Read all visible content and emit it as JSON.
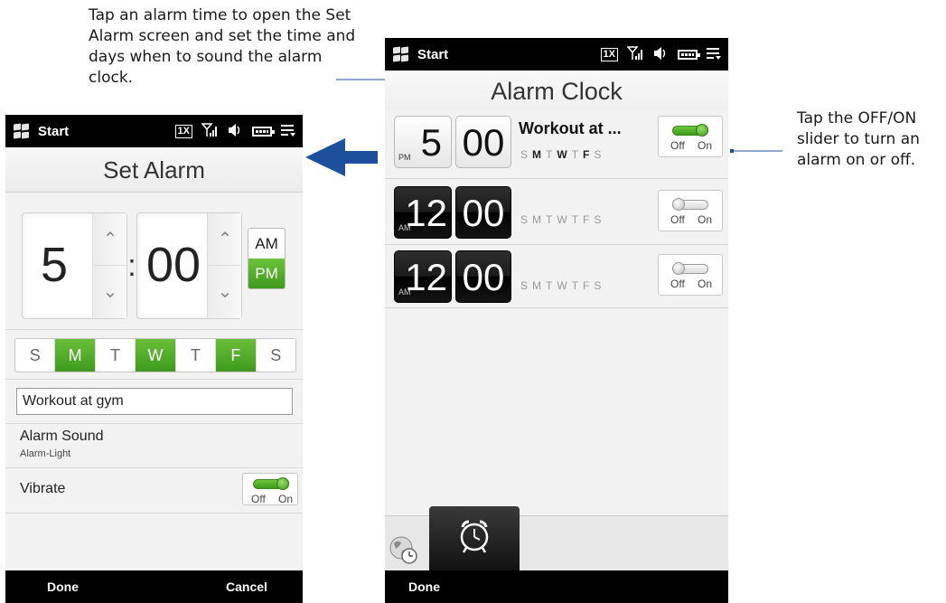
{
  "callouts": {
    "left": "Tap an alarm time to open the Set Alarm screen and set the time and days when to sound the alarm clock.",
    "right": "Tap the OFF/ON slider to turn an alarm on or off."
  },
  "status_bar": {
    "start_label": "Start",
    "network_badge": "1X",
    "icons": [
      "windows-logo-icon",
      "signal-icon",
      "speaker-icon",
      "battery-icon",
      "menu-icon"
    ]
  },
  "set_alarm": {
    "title": "Set Alarm",
    "hour": "5",
    "colon": ":",
    "minute": "00",
    "am_label": "AM",
    "pm_label": "PM",
    "meridiem_selected": "PM",
    "days": [
      {
        "label": "S",
        "on": false
      },
      {
        "label": "M",
        "on": true
      },
      {
        "label": "T",
        "on": false
      },
      {
        "label": "W",
        "on": true
      },
      {
        "label": "T",
        "on": false
      },
      {
        "label": "F",
        "on": true
      },
      {
        "label": "S",
        "on": false
      }
    ],
    "description": "Workout at gym",
    "alarm_sound_label": "Alarm Sound",
    "alarm_sound_value": "Alarm-Light",
    "vibrate_label": "Vibrate",
    "vibrate_on": true,
    "toggle_off": "Off",
    "toggle_on": "On",
    "softkey_left": "Done",
    "softkey_right": "Cancel"
  },
  "alarm_clock": {
    "title": "Alarm Clock",
    "alarms": [
      {
        "meridiem": "PM",
        "hour": "5",
        "minute": "00",
        "name": "Workout at ...",
        "enabled": true,
        "days": [
          {
            "l": "S",
            "on": false
          },
          {
            "l": "M",
            "on": true
          },
          {
            "l": "T",
            "on": false
          },
          {
            "l": "W",
            "on": true
          },
          {
            "l": "T",
            "on": false
          },
          {
            "l": "F",
            "on": true
          },
          {
            "l": "S",
            "on": false
          }
        ]
      },
      {
        "meridiem": "AM",
        "hour": "12",
        "minute": "00",
        "name": "",
        "enabled": false,
        "days": [
          {
            "l": "S",
            "on": false
          },
          {
            "l": "M",
            "on": false
          },
          {
            "l": "T",
            "on": false
          },
          {
            "l": "W",
            "on": false
          },
          {
            "l": "T",
            "on": false
          },
          {
            "l": "F",
            "on": false
          },
          {
            "l": "S",
            "on": false
          }
        ]
      },
      {
        "meridiem": "AM",
        "hour": "12",
        "minute": "00",
        "name": "",
        "enabled": false,
        "days": [
          {
            "l": "S",
            "on": false
          },
          {
            "l": "M",
            "on": false
          },
          {
            "l": "T",
            "on": false
          },
          {
            "l": "W",
            "on": false
          },
          {
            "l": "T",
            "on": false
          },
          {
            "l": "F",
            "on": false
          },
          {
            "l": "S",
            "on": false
          }
        ]
      }
    ],
    "toggle_off": "Off",
    "toggle_on": "On",
    "softkey_left": "Done"
  },
  "colors": {
    "accent_green": "#4aa624",
    "arrow_blue": "#1d4f9c",
    "softkey_bg": "#000000"
  }
}
